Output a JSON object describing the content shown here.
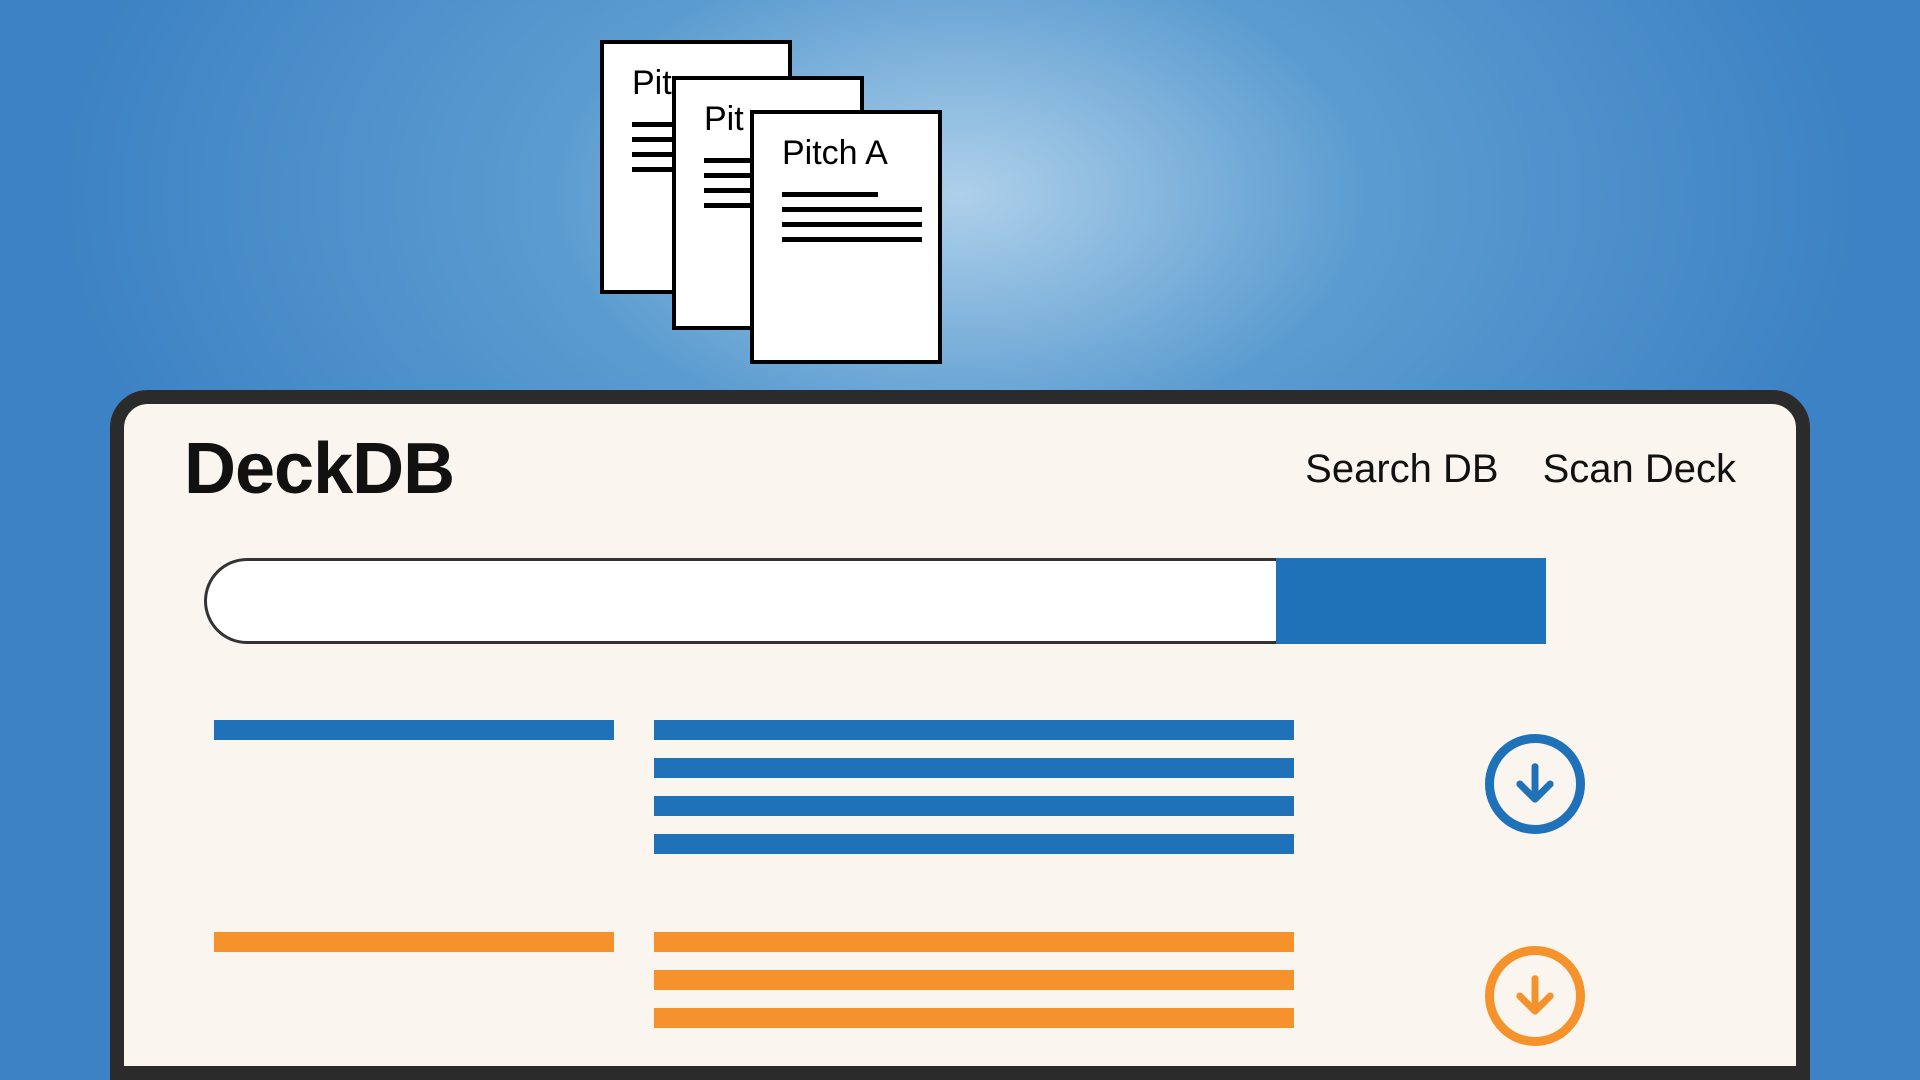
{
  "stack": {
    "labels": [
      "Pit",
      "Pit",
      "Pitch A"
    ]
  },
  "app": {
    "logo": "DeckDB",
    "nav": {
      "search_db": "Search DB",
      "scan_deck": "Scan Deck"
    },
    "search": {
      "value": "",
      "placeholder": "",
      "submit_label": ""
    },
    "results": [
      {
        "color": "blue",
        "body_lines": 4,
        "action_icon": "download-icon"
      },
      {
        "color": "orange",
        "body_lines": 3,
        "action_icon": "download-icon"
      }
    ],
    "colors": {
      "blue": "#1f71b8",
      "orange": "#f5922c",
      "frame": "#2b2b2b",
      "panel": "#faf6ef"
    }
  }
}
